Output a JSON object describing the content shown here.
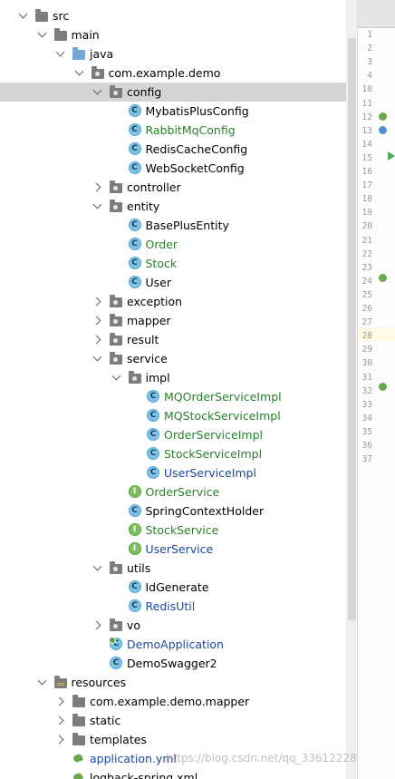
{
  "project_tree": {
    "items": [
      {
        "label": "src",
        "kind": "folder",
        "expand": "down",
        "color": "black"
      },
      {
        "label": "main",
        "kind": "folder",
        "expand": "down",
        "color": "black"
      },
      {
        "label": "java",
        "kind": "folder-blue",
        "expand": "down",
        "color": "black"
      },
      {
        "label": "com.example.demo",
        "kind": "package",
        "expand": "down",
        "color": "black"
      },
      {
        "label": "config",
        "kind": "package",
        "expand": "down",
        "color": "black",
        "selected": true
      },
      {
        "label": "MybatisPlusConfig",
        "kind": "class",
        "color": "black"
      },
      {
        "label": "RabbitMqConfig",
        "kind": "class",
        "color": "green"
      },
      {
        "label": "RedisCacheConfig",
        "kind": "class",
        "color": "black"
      },
      {
        "label": "WebSocketConfig",
        "kind": "class",
        "color": "black"
      },
      {
        "label": "controller",
        "kind": "package",
        "expand": "right",
        "color": "black"
      },
      {
        "label": "entity",
        "kind": "package",
        "expand": "down",
        "color": "black"
      },
      {
        "label": "BasePlusEntity",
        "kind": "class",
        "color": "black"
      },
      {
        "label": "Order",
        "kind": "class",
        "color": "green"
      },
      {
        "label": "Stock",
        "kind": "class",
        "color": "green"
      },
      {
        "label": "User",
        "kind": "class",
        "color": "black"
      },
      {
        "label": "exception",
        "kind": "package",
        "expand": "right",
        "color": "black"
      },
      {
        "label": "mapper",
        "kind": "package",
        "expand": "right",
        "color": "black"
      },
      {
        "label": "result",
        "kind": "package",
        "expand": "right",
        "color": "black"
      },
      {
        "label": "service",
        "kind": "package",
        "expand": "down",
        "color": "black"
      },
      {
        "label": "impl",
        "kind": "package",
        "expand": "down",
        "color": "black"
      },
      {
        "label": "MQOrderServiceImpl",
        "kind": "class",
        "color": "green"
      },
      {
        "label": "MQStockServiceImpl",
        "kind": "class",
        "color": "green"
      },
      {
        "label": "OrderServiceImpl",
        "kind": "class",
        "color": "green"
      },
      {
        "label": "StockServiceImpl",
        "kind": "class",
        "color": "green"
      },
      {
        "label": "UserServiceImpl",
        "kind": "class",
        "color": "blue"
      },
      {
        "label": "OrderService",
        "kind": "interface",
        "color": "green"
      },
      {
        "label": "SpringContextHolder",
        "kind": "class",
        "color": "black"
      },
      {
        "label": "StockService",
        "kind": "interface",
        "color": "green"
      },
      {
        "label": "UserService",
        "kind": "interface",
        "color": "blue"
      },
      {
        "label": "utils",
        "kind": "package",
        "expand": "down",
        "color": "black"
      },
      {
        "label": "IdGenerate",
        "kind": "class",
        "color": "black"
      },
      {
        "label": "RedisUtil",
        "kind": "class",
        "color": "blue"
      },
      {
        "label": "vo",
        "kind": "package",
        "expand": "right",
        "color": "black"
      },
      {
        "label": "DemoApplication",
        "kind": "class-run",
        "color": "blue"
      },
      {
        "label": "DemoSwagger2",
        "kind": "class",
        "color": "black"
      },
      {
        "label": "resources",
        "kind": "folder-res",
        "expand": "down",
        "color": "black"
      },
      {
        "label": "com.example.demo.mapper",
        "kind": "folder",
        "expand": "right",
        "color": "black"
      },
      {
        "label": "static",
        "kind": "folder",
        "expand": "right",
        "color": "black"
      },
      {
        "label": "templates",
        "kind": "folder",
        "expand": "right",
        "color": "black"
      },
      {
        "label": "application.yml",
        "kind": "yml",
        "color": "blue"
      },
      {
        "label": "logback-spring.xml",
        "kind": "xml",
        "color": "black"
      }
    ]
  },
  "editor_gutter": {
    "line_numbers": [
      "1",
      "2",
      "3",
      "4",
      "10",
      "11",
      "12",
      "13",
      "14",
      "15",
      "16",
      "17",
      "18",
      "19",
      "20",
      "21",
      "22",
      "23",
      "24",
      "25",
      "26",
      "27",
      "28",
      "29",
      "30",
      "31",
      "32",
      "33",
      "34",
      "35",
      "36",
      "37"
    ],
    "current_line": "28"
  },
  "watermark": "https://blog.csdn.net/qq_33612228",
  "colors": {
    "selected_row": "#d5d5d5",
    "green_text": "#29802c",
    "blue_text": "#1d47a4",
    "class_badge": "#7dc3e8",
    "interface_badge": "#7fbf5e"
  },
  "icons": {
    "folder": "folder-icon",
    "package": "package-icon",
    "class": "class-c-icon",
    "interface": "interface-i-icon",
    "yml": "yml-icon"
  }
}
